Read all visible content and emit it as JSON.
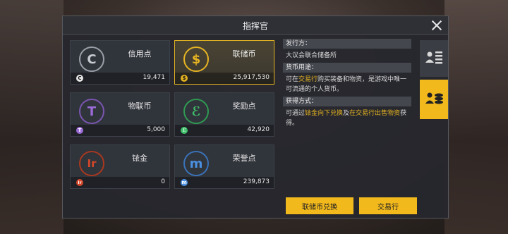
{
  "window": {
    "title": "指挥官"
  },
  "currencies": [
    {
      "name": "信用点",
      "letter": "C",
      "amount": "19,471",
      "color": "#c8ccd2",
      "selected": false
    },
    {
      "name": "联储币",
      "letter": "$",
      "amount": "25,917,530",
      "color": "#e6b422",
      "selected": true
    },
    {
      "name": "物联币",
      "letter": "T",
      "amount": "5,000",
      "color": "#9b6cd8",
      "selected": false
    },
    {
      "name": "奖励点",
      "letter": "ℰ",
      "amount": "42,920",
      "color": "#3fbf6a",
      "selected": false
    },
    {
      "name": "铱金",
      "letter": "Ir",
      "amount": "0",
      "color": "#d2462a",
      "selected": false
    },
    {
      "name": "荣誉点",
      "letter": "m",
      "amount": "239,873",
      "color": "#4a8fe0",
      "selected": false
    }
  ],
  "info": {
    "issuer_header": "发行方：",
    "issuer_text": "大议会联合储备所",
    "usage_header": "货币用途：",
    "usage_prefix": "可在",
    "usage_link": "交易行",
    "usage_suffix": "购买装备和物资，是游戏中唯一可流通的个人货币。",
    "obtain_header": "获得方式：",
    "obtain_prefix": "可通过",
    "obtain_link1": "铱金向下兑换",
    "obtain_mid": "及",
    "obtain_link2": "在交易行出售物资",
    "obtain_suffix": "获得。"
  },
  "tabs": [
    {
      "icon": "profile-card-icon",
      "active": false
    },
    {
      "icon": "wallet-coins-icon",
      "active": true
    }
  ],
  "buttons": {
    "exchange": "联储币兑换",
    "market": "交易行"
  },
  "colors": {
    "accent": "#f2b91c"
  }
}
